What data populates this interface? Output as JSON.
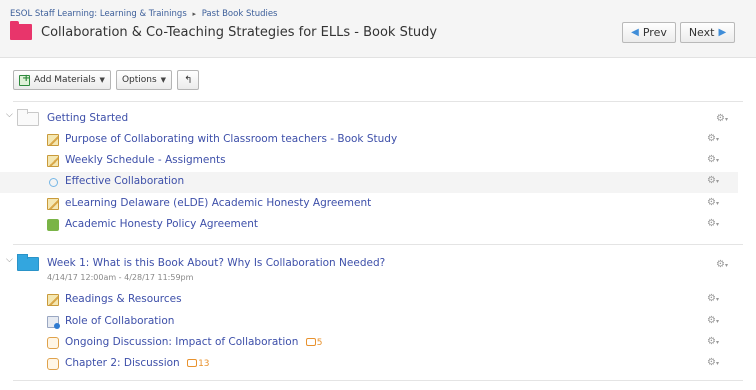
{
  "breadcrumb": {
    "parent": "ESOL Staff Learning: Learning & Trainings",
    "current": "Past Book Studies"
  },
  "page": {
    "title": "Collaboration & Co-Teaching Strategies for ELLs - Book Study"
  },
  "nav": {
    "prev_label": "Prev",
    "next_label": "Next"
  },
  "toolbar": {
    "add_materials_label": "Add Materials",
    "options_label": "Options"
  },
  "modules": [
    {
      "title": "Getting Started",
      "items": [
        {
          "label": "Purpose of Collaborating with Classroom teachers - Book Study",
          "icon": "assignment-icon"
        },
        {
          "label": "Weekly Schedule - Assigments",
          "icon": "assignment-icon"
        },
        {
          "label": "Effective Collaboration",
          "icon": "link-icon"
        },
        {
          "label": "eLearning Delaware (eLDE) Academic Honesty Agreement",
          "icon": "assignment-icon"
        },
        {
          "label": "Academic Honesty Policy Agreement",
          "icon": "badge-icon"
        }
      ]
    },
    {
      "title": "Week 1: What is this Book About? Why Is Collaboration Needed?",
      "subtitle": "4/14/17 12:00am - 4/28/17 11:59pm",
      "items": [
        {
          "label": "Readings & Resources",
          "icon": "assignment-icon"
        },
        {
          "label": "Role of Collaboration",
          "icon": "resource-icon"
        },
        {
          "label": "Ongoing Discussion: Impact of Collaboration",
          "icon": "discussion-icon",
          "count": "5"
        },
        {
          "label": "Chapter 2: Discussion",
          "icon": "discussion-icon",
          "count": "13"
        }
      ]
    }
  ],
  "colors": {
    "accent_link": "#3d4fa9",
    "course_folder": "#e8356b",
    "week_folder": "#33a6df",
    "discussion_count": "#e8922e"
  }
}
